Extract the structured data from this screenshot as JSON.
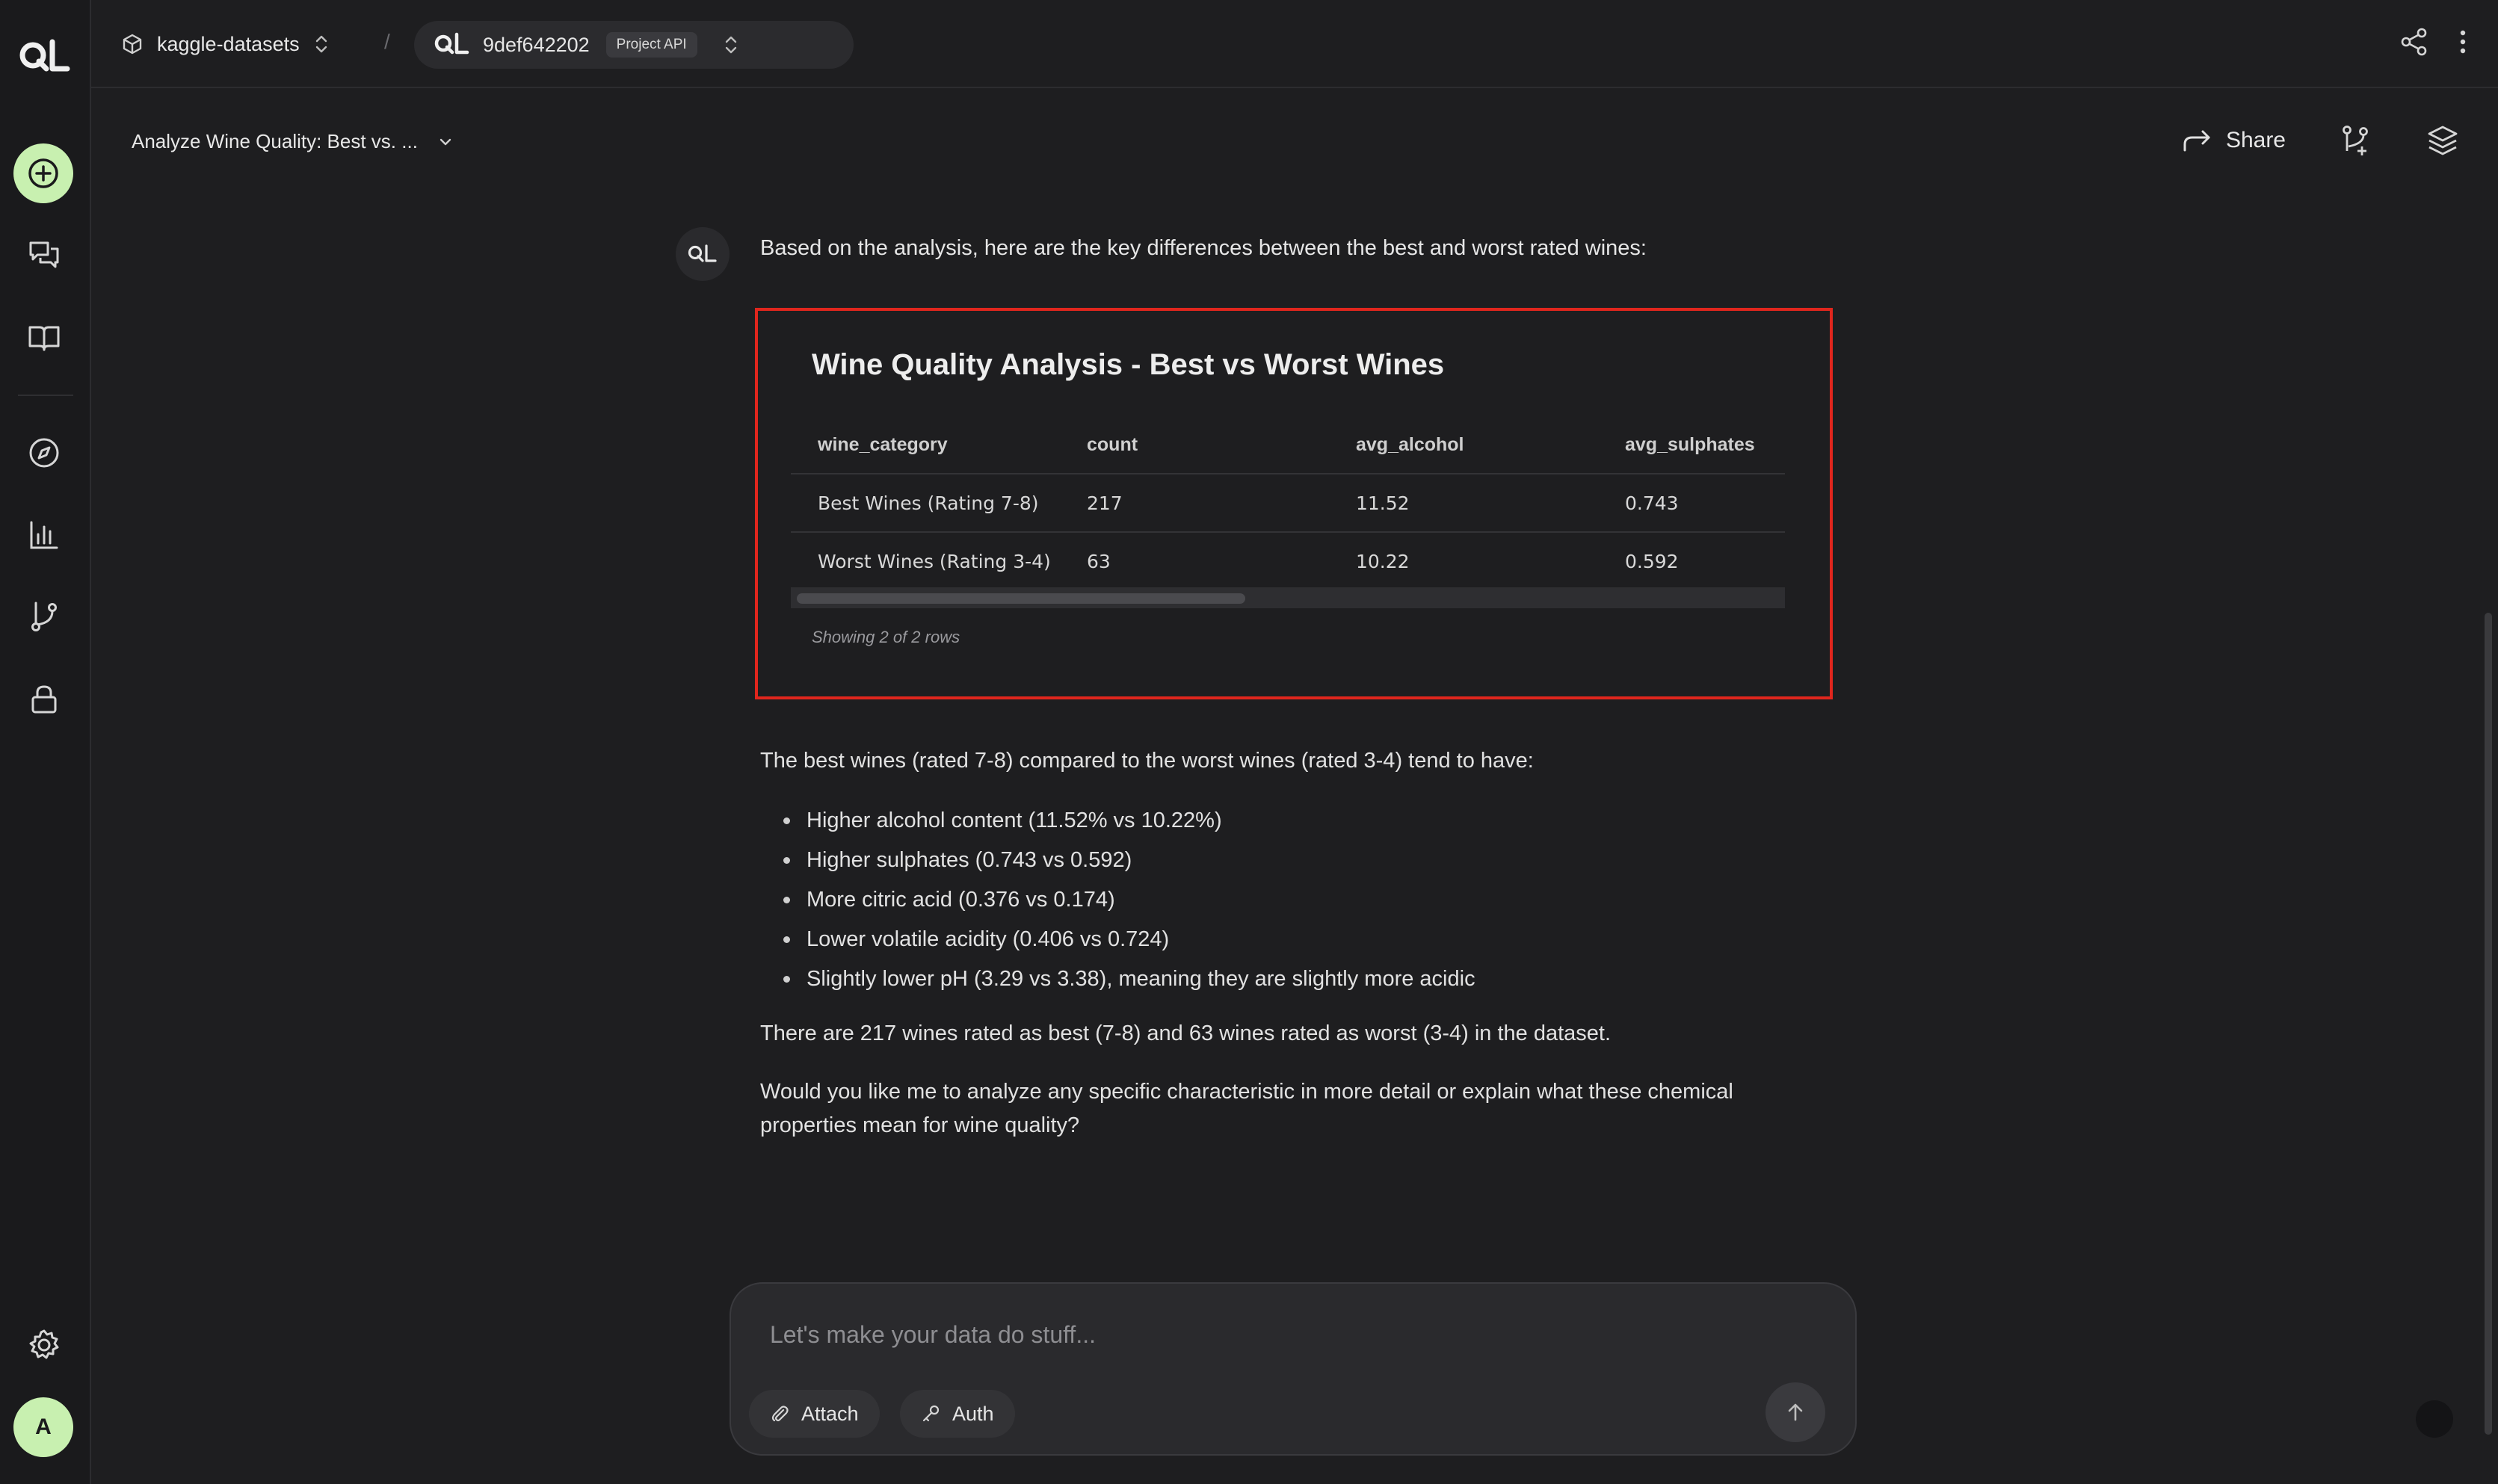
{
  "topbar": {
    "project_name": "kaggle-datasets",
    "separator": "/",
    "api_id": "9def642202",
    "api_badge": "Project API"
  },
  "header": {
    "chat_title": "Analyze Wine Quality: Best vs. ...",
    "share_label": "Share"
  },
  "sidebar": {
    "avatar_letter": "A",
    "items": [
      "new-chat",
      "chats",
      "docs",
      "explore",
      "analytics",
      "branches",
      "security",
      "settings"
    ]
  },
  "message": {
    "intro": "Based on the analysis, here are the key differences between the best and worst rated wines:",
    "card": {
      "title": "Wine Quality Analysis - Best vs Worst Wines",
      "columns": [
        "wine_category",
        "count",
        "avg_alcohol",
        "avg_sulphates"
      ],
      "rows": [
        [
          "Best Wines (Rating 7-8)",
          "217",
          "11.52",
          "0.743"
        ],
        [
          "Worst Wines (Rating 3-4)",
          "63",
          "10.22",
          "0.592"
        ]
      ],
      "row_count": "Showing 2 of 2 rows"
    },
    "summary": "The best wines (rated 7-8) compared to the worst wines (rated 3-4) tend to have:",
    "bullets": [
      "Higher alcohol content (11.52% vs 10.22%)",
      "Higher sulphates (0.743 vs 0.592)",
      "More citric acid (0.376 vs 0.174)",
      "Lower volatile acidity (0.406 vs 0.724)",
      "Slightly lower pH (3.29 vs 3.38), meaning they are slightly more acidic"
    ],
    "counts_text": "There are 217 wines rated as best (7-8) and 63 wines rated as worst (3-4) in the dataset.",
    "followup": "Would you like me to analyze any specific characteristic in more detail or explain what these chemical properties mean for wine quality?"
  },
  "composer": {
    "placeholder": "Let's make your data do stuff...",
    "value": "",
    "attach_label": "Attach",
    "auth_label": "Auth"
  },
  "colors": {
    "accent": "#c8f0b0",
    "highlight_border": "#e0261d",
    "background": "#1e1e20"
  }
}
